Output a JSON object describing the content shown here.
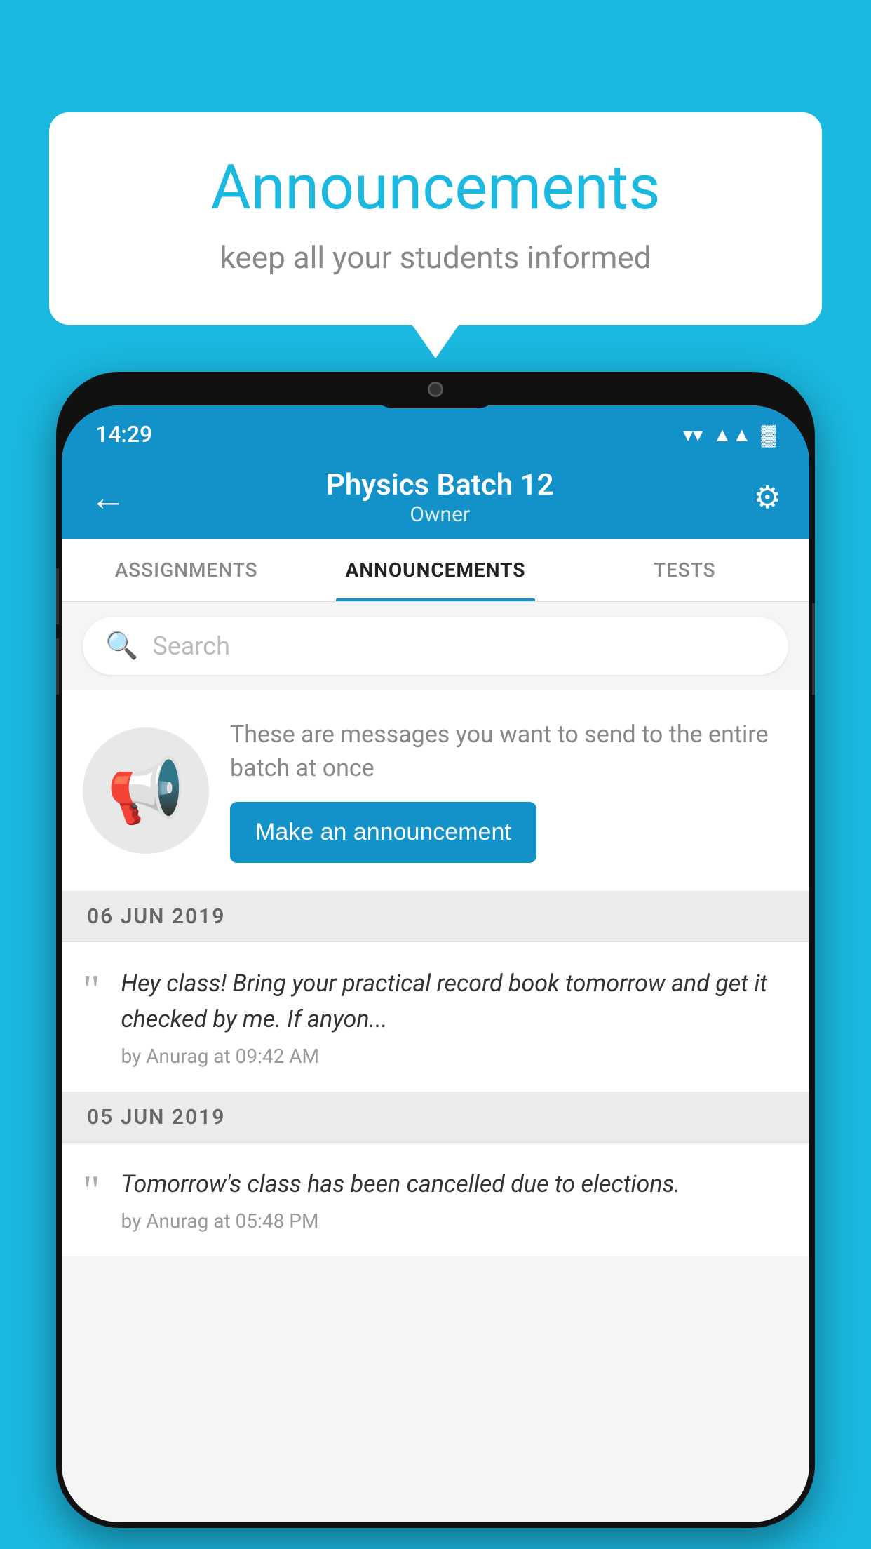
{
  "bubble": {
    "title": "Announcements",
    "subtitle": "keep all your students informed"
  },
  "status_bar": {
    "time": "14:29",
    "wifi": "▼",
    "signal": "▲",
    "battery": "▓"
  },
  "app_bar": {
    "back_icon": "←",
    "title": "Physics Batch 12",
    "subtitle": "Owner",
    "settings_icon": "⚙"
  },
  "tabs": [
    {
      "label": "ASSIGNMENTS",
      "active": false
    },
    {
      "label": "ANNOUNCEMENTS",
      "active": true
    },
    {
      "label": "TESTS",
      "active": false
    }
  ],
  "search": {
    "placeholder": "Search"
  },
  "promo": {
    "description": "These are messages you want to send to the entire batch at once",
    "button_label": "Make an announcement"
  },
  "announcements": [
    {
      "date": "06  JUN  2019",
      "text": "Hey class! Bring your practical record book tomorrow and get it checked by me. If anyon...",
      "meta": "by Anurag at 09:42 AM"
    },
    {
      "date": "05  JUN  2019",
      "text": "Tomorrow's class has been cancelled due to elections.",
      "meta": "by Anurag at 05:48 PM"
    }
  ]
}
